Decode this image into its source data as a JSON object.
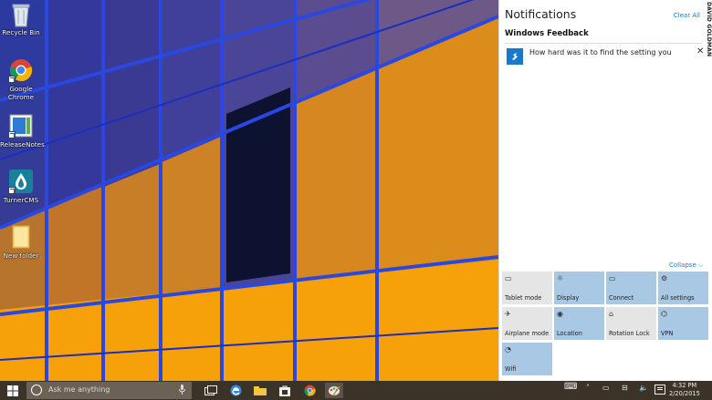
{
  "desktop": {
    "icons": [
      {
        "label": "Recycle Bin",
        "icon": "recycle-bin-icon"
      },
      {
        "label": "Google\nChrome",
        "icon": "chrome-icon"
      },
      {
        "label": "ReleaseNotes",
        "icon": "document-icon"
      },
      {
        "label": "TurnerCMS",
        "icon": "turnercms-icon"
      },
      {
        "label": "New folder",
        "icon": "folder-icon"
      }
    ]
  },
  "action_center": {
    "title": "Notifications",
    "clear_all": "Clear All",
    "credit": "DAVID GOLDMAN",
    "group_title": "Windows Feedback",
    "notification": {
      "text": "How hard was it to find the setting you",
      "close": "✕"
    },
    "collapse": "Collapse ⌵",
    "quick_actions": [
      {
        "label": "Tablet mode",
        "icon": "tablet-icon",
        "glyph": "▭",
        "on": false
      },
      {
        "label": "Display",
        "icon": "display-icon",
        "glyph": "☼",
        "on": true
      },
      {
        "label": "Connect",
        "icon": "connect-icon",
        "glyph": "▭",
        "on": true
      },
      {
        "label": "All settings",
        "icon": "gear-icon",
        "glyph": "⚙",
        "on": true
      },
      {
        "label": "Airplane mode",
        "icon": "airplane-icon",
        "glyph": "✈",
        "on": false
      },
      {
        "label": "Location",
        "icon": "location-icon",
        "glyph": "◉",
        "on": true
      },
      {
        "label": "Rotation Lock",
        "icon": "rotation-lock-icon",
        "glyph": "⌂",
        "on": false
      },
      {
        "label": "VPN",
        "icon": "vpn-icon",
        "glyph": "⌬",
        "on": true
      },
      {
        "label": "Wifi",
        "icon": "wifi-icon",
        "glyph": "◔",
        "on": true
      }
    ]
  },
  "taskbar": {
    "search_placeholder": "Ask me anything",
    "apps": [
      "task-view-icon",
      "edge-icon",
      "file-explorer-icon",
      "store-icon",
      "chrome-icon",
      "paint-icon"
    ],
    "tray": {
      "keyboard": "⌨",
      "chevron": "˄",
      "network": "▭",
      "volume": "🔈"
    },
    "time": "4:32 PM",
    "date": "2/20/2015"
  },
  "colors": {
    "accent": "#1979ca",
    "tile_on": "#a8c8e4",
    "tile_off": "#e5e5e5",
    "taskbar": "#3b3328"
  }
}
